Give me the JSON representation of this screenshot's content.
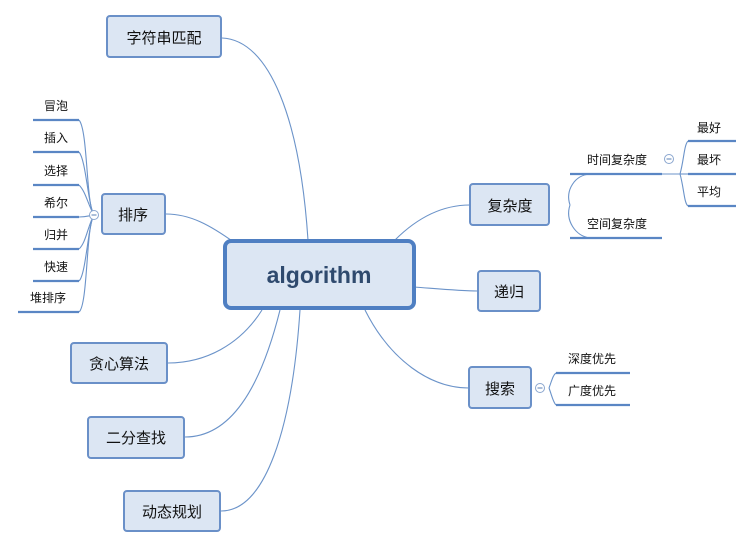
{
  "root": {
    "label": "algorithm"
  },
  "branches": {
    "string_matching": {
      "label": "字符串匹配"
    },
    "sorting": {
      "label": "排序",
      "children": [
        "冒泡",
        "插入",
        "选择",
        "希尔",
        "归并",
        "快速",
        "堆排序"
      ]
    },
    "greedy": {
      "label": "贪心算法"
    },
    "binary_search": {
      "label": "二分查找"
    },
    "dynamic_programming": {
      "label": "动态规划"
    },
    "complexity": {
      "label": "复杂度",
      "time": {
        "label": "时间复杂度",
        "children": [
          "最好",
          "最坏",
          "平均"
        ]
      },
      "space": {
        "label": "空间复杂度"
      }
    },
    "recursion": {
      "label": "递归"
    },
    "search": {
      "label": "搜索",
      "children": [
        "深度优先",
        "广度优先"
      ]
    }
  },
  "colors": {
    "node_fill": "#dce6f3",
    "node_border": "#6a90c8",
    "root_border": "#4f7fc2",
    "connector": "#6b93c9",
    "root_text": "#2f4a6e"
  },
  "icons": {
    "collapse": "minus-circle-icon"
  }
}
